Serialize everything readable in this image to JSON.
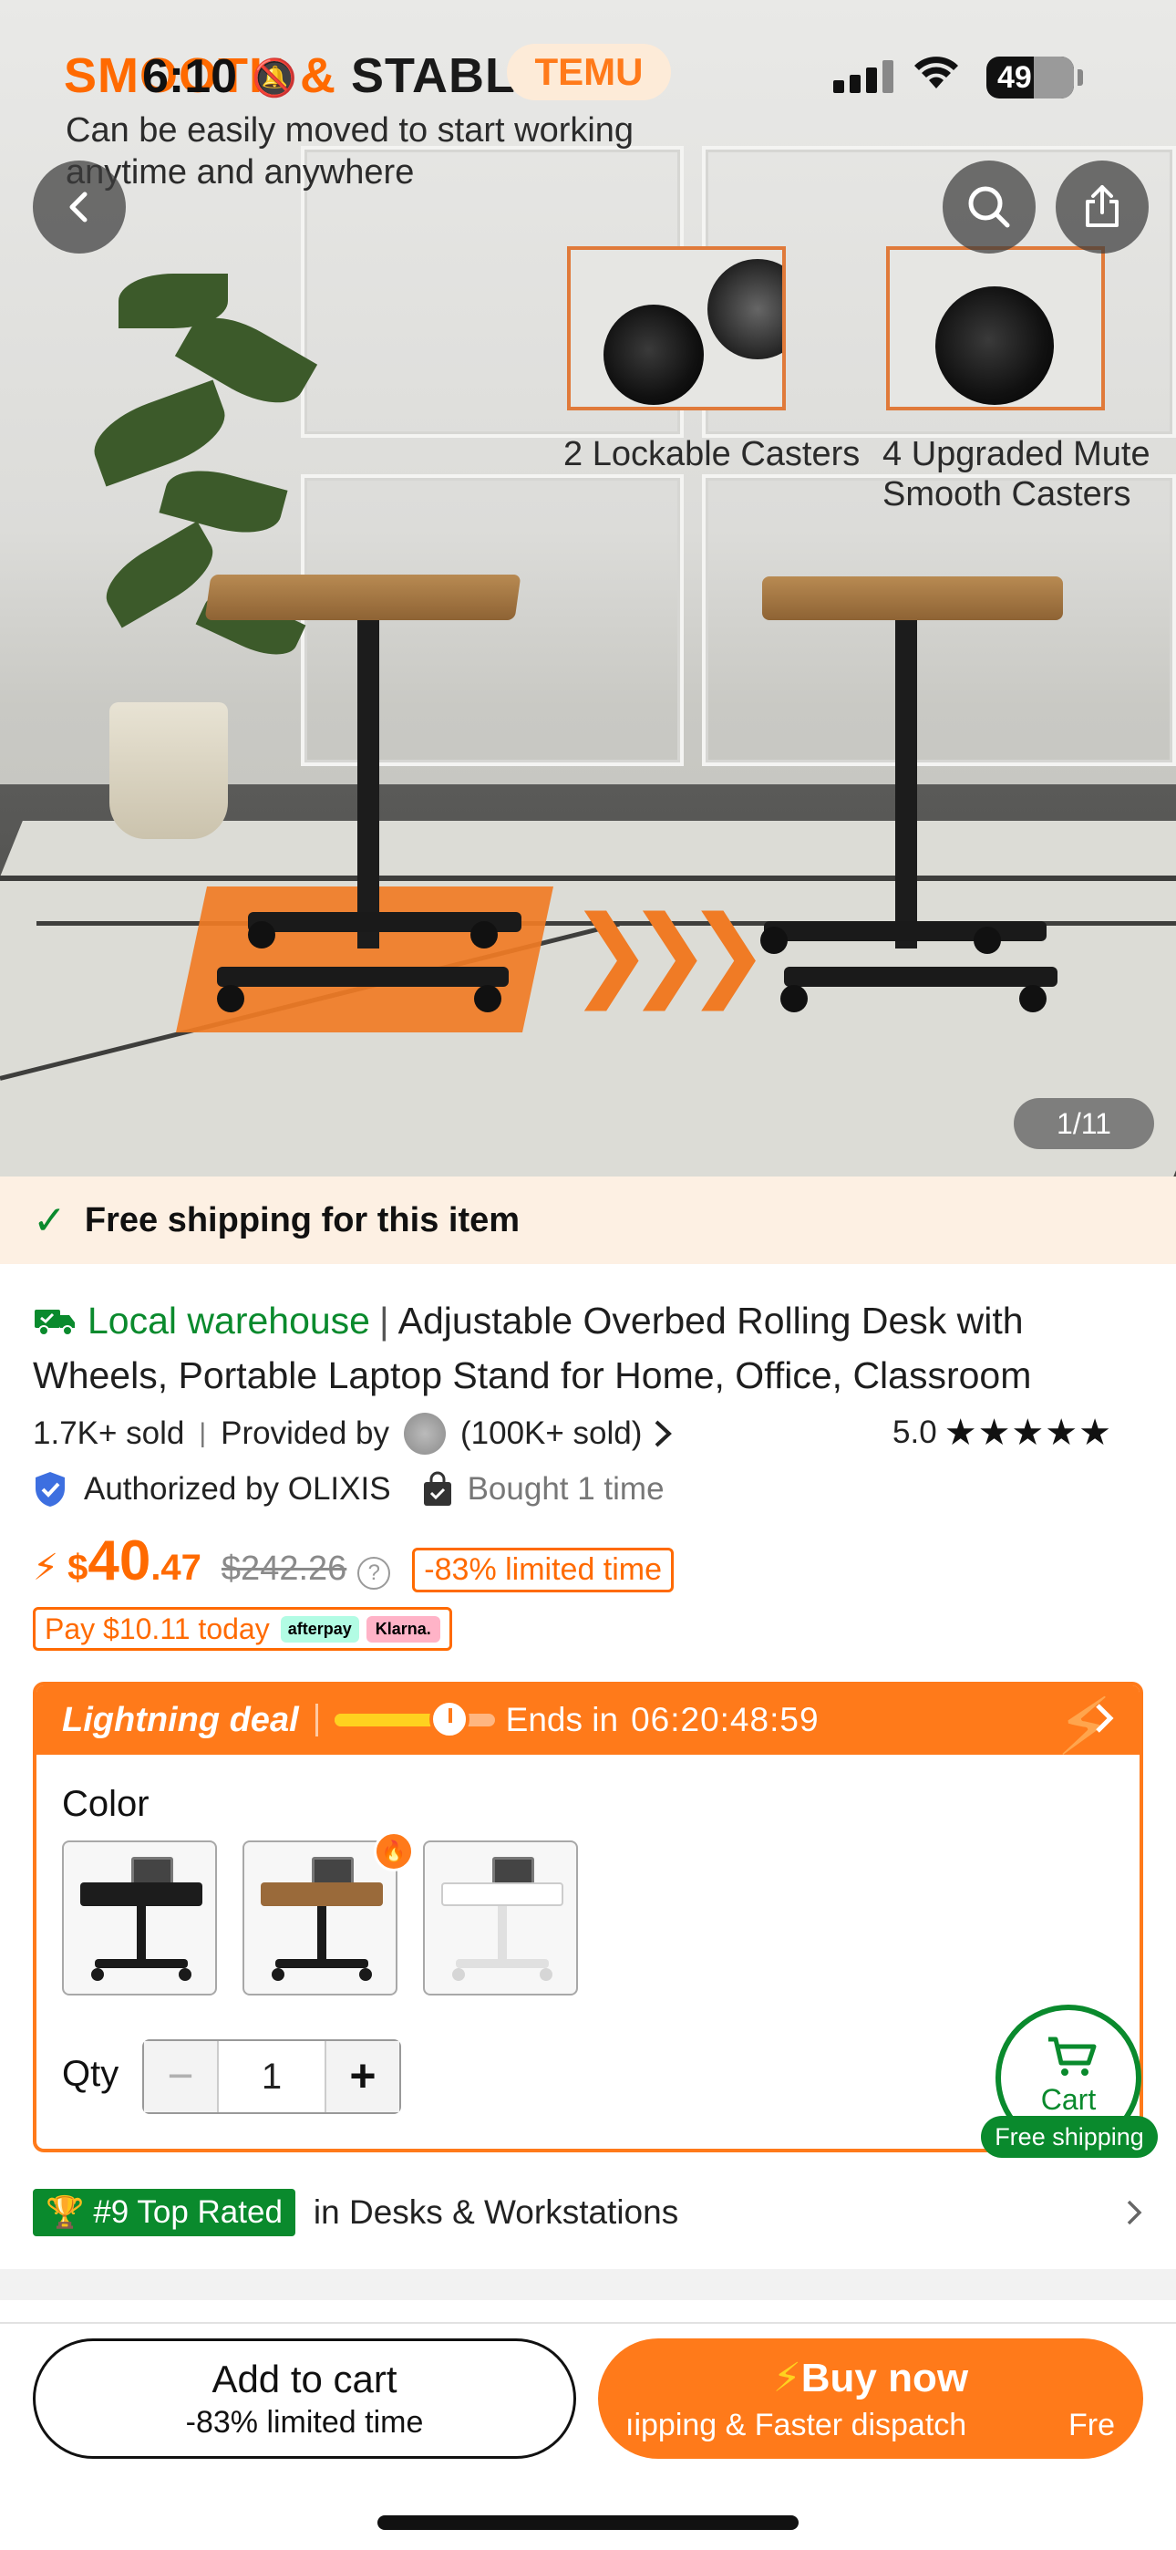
{
  "status_bar": {
    "time": "6:10",
    "app_badge": "TEMU",
    "battery": "49"
  },
  "hero": {
    "headline_orange": "SMOOTH & ",
    "headline_dark": "STABLE",
    "subtitle": "Can be easily moved to start working anytime and anywhere",
    "caster_label_1": "2 Lockable Casters",
    "caster_label_2": "4 Upgraded Mute Smooth Casters",
    "image_counter": "1/11"
  },
  "shipping_banner": {
    "text": "Free shipping for this item"
  },
  "product": {
    "warehouse_label": "Local warehouse",
    "title": "Adjustable Overbed Rolling Desk with Wheels, Portable Laptop Stand for Home, Office, Classroom",
    "sold": "1.7K+ sold",
    "provided_by": "Provided by",
    "provider_sold": "(100K+ sold)",
    "rating": "5.0",
    "stars": "★★★★★",
    "authorized": "Authorized by OLIXIS",
    "bought": "Bought 1 time"
  },
  "price": {
    "currency": "$",
    "integer": "40",
    "decimal": ".47",
    "original": "$242.26",
    "discount": "-83% limited time",
    "pay_today": "Pay $10.11 today",
    "afterpay": "afterpay",
    "klarna": "Klarna."
  },
  "deal": {
    "label": "Lightning deal",
    "progress_fraction": 0.72,
    "ends_in": "Ends in",
    "timer": "06:20:48:59",
    "color_label": "Color",
    "swatches": [
      {
        "name": "Black",
        "top": "#1c1c1c",
        "frame": "#1a1a1a"
      },
      {
        "name": "Brown",
        "top": "#9a6a3a",
        "frame": "#1a1a1a"
      },
      {
        "name": "White",
        "top": "#f4f4f4",
        "frame": "#e8e8e8"
      }
    ],
    "qty_label": "Qty",
    "qty_value": "1",
    "minus": "−",
    "plus": "+"
  },
  "floating_cart": {
    "label": "Cart",
    "free_shipping": "Free shipping"
  },
  "ranking": {
    "badge": "#9 Top Rated",
    "category": "in Desks & Workstations"
  },
  "bottom_bar": {
    "add_to_cart": "Add to cart",
    "add_to_cart_sub": "-83% limited time",
    "buy_now": "Buy now",
    "buy_now_sub": "ıipping & Faster dispatch",
    "buy_now_sub_2": "Fre"
  },
  "colors": {
    "accent": "#ff7a1a",
    "green": "#0a8a2d",
    "banner_bg": "#fdf0e3"
  }
}
